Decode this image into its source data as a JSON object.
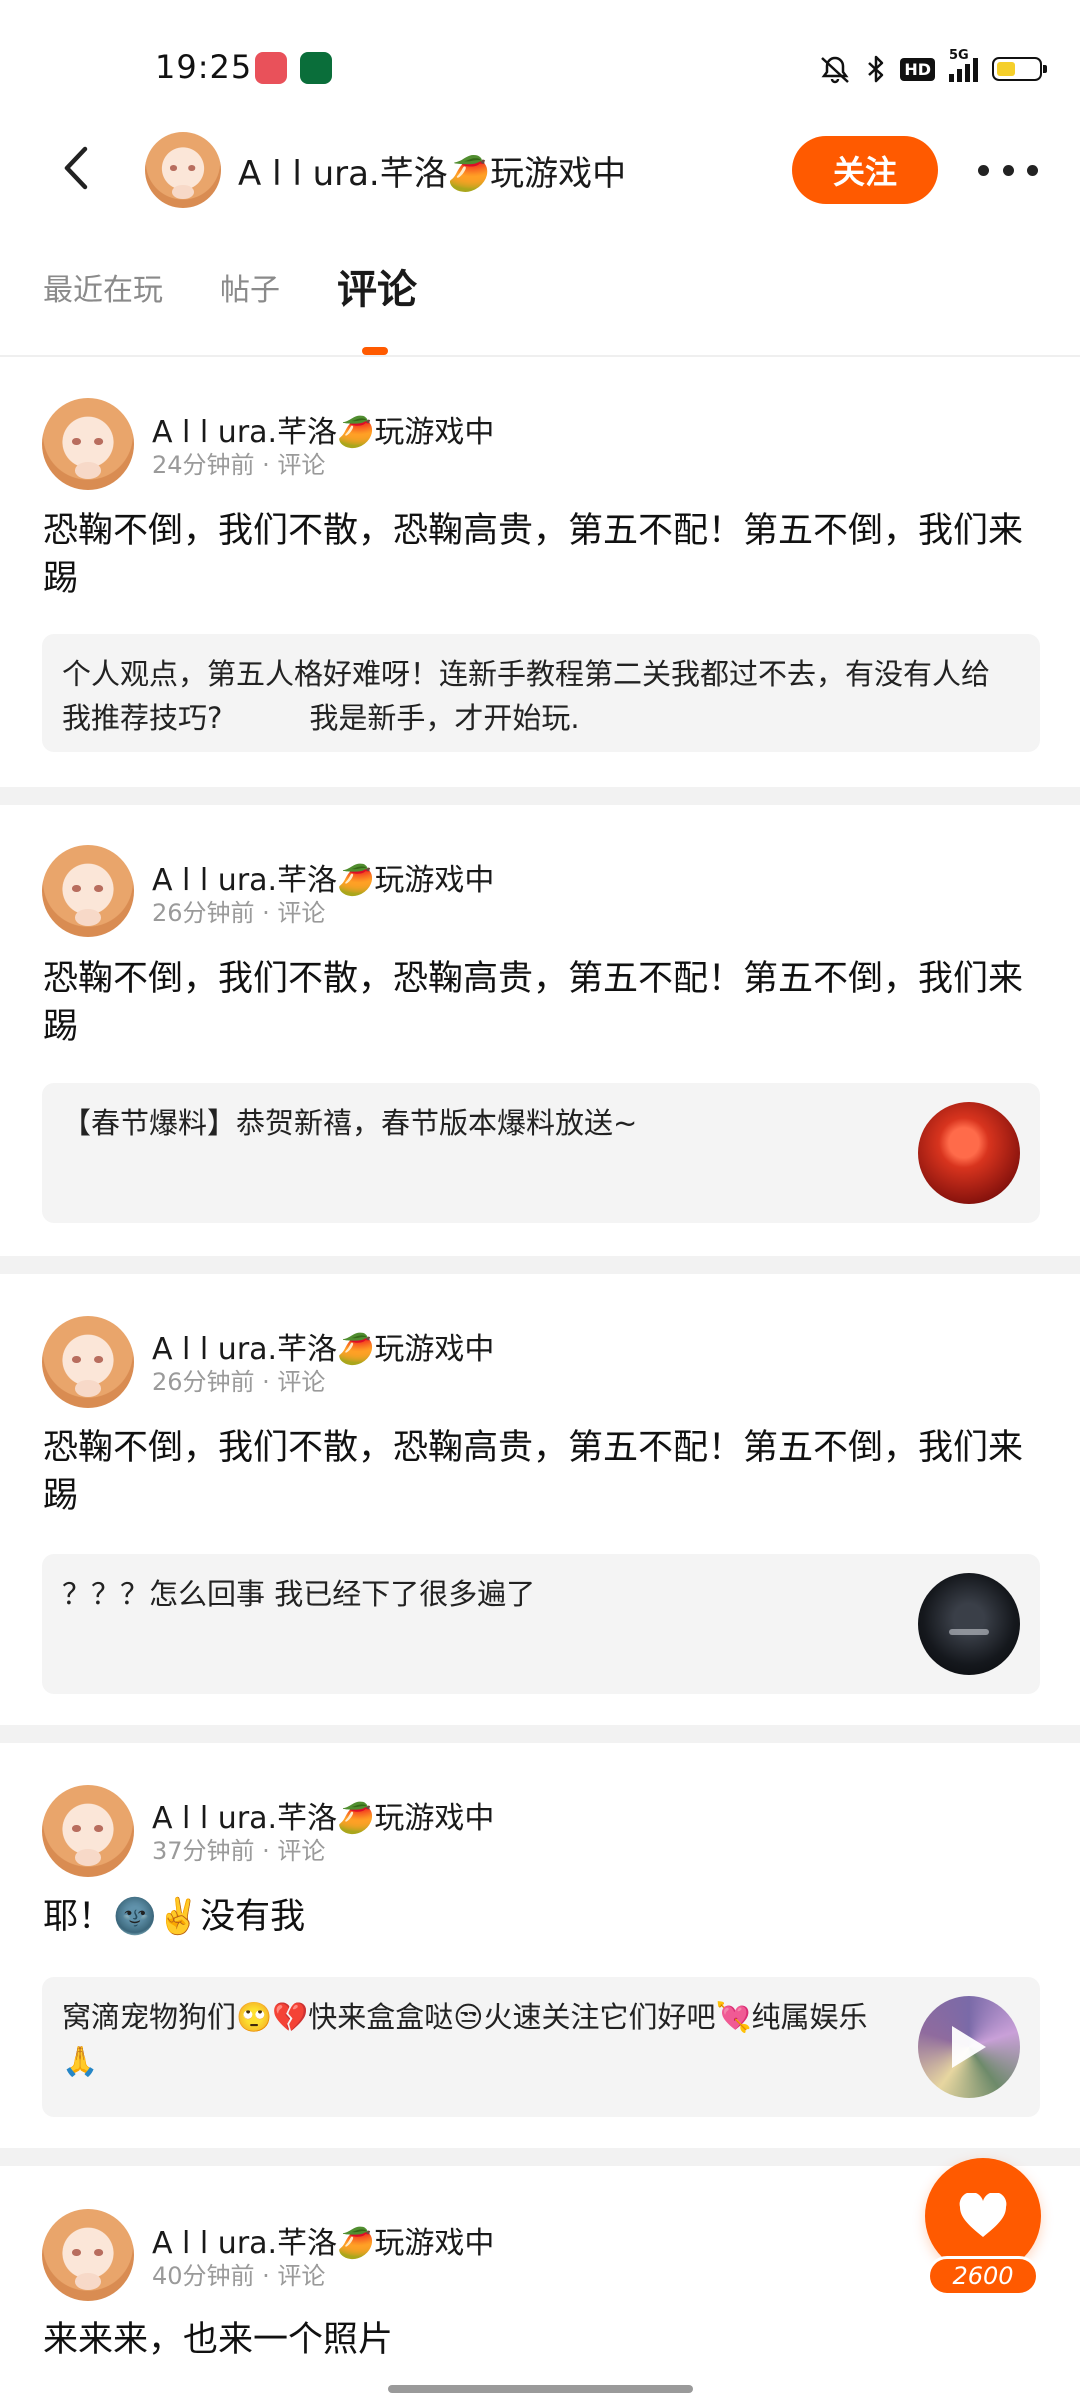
{
  "status_bar": {
    "time": "19:25",
    "hd_label": "HD",
    "network_label": "5G",
    "battery_percent": 40
  },
  "header": {
    "username": "A l l ura.芊洛🥭玩游戏中",
    "follow_label": "关注"
  },
  "tabs": [
    {
      "label": "最近在玩",
      "active": false
    },
    {
      "label": "帖子",
      "active": false
    },
    {
      "label": "评论",
      "active": true
    }
  ],
  "comments": [
    {
      "author": "A l l ura.芊洛🥭玩游戏中",
      "meta": "24分钟前 · 评论",
      "text": "恐鞠不倒，我们不散，恐鞠高贵，第五不配！第五不倒，我们来踢",
      "ref_text": "个人观点，第五人格好难呀！连新手教程第二关我都过不去，有没有人给我推荐技巧?　　　我是新手，才开始玩.",
      "thumb": null
    },
    {
      "author": "A l l ura.芊洛🥭玩游戏中",
      "meta": "26分钟前 · 评论",
      "text": "恐鞠不倒，我们不散，恐鞠高贵，第五不配！第五不倒，我们来踢",
      "ref_text": "【春节爆料】恭贺新禧，春节版本爆料放送~",
      "thumb": "red"
    },
    {
      "author": "A l l ura.芊洛🥭玩游戏中",
      "meta": "26分钟前 · 评论",
      "text": "恐鞠不倒，我们不散，恐鞠高贵，第五不配！第五不倒，我们来踢",
      "ref_text": "？？？怎么回事 我已经下了很多遍了",
      "thumb": "dark"
    },
    {
      "author": "A l l ura.芊洛🥭玩游戏中",
      "meta": "37分钟前 · 评论",
      "text": "耶！🌚✌️没有我",
      "ref_text": "窝滴宠物狗们🙄💔快来盒盒哒😒火速关注它们好吧💘纯属娱乐🙏",
      "thumb": "video"
    },
    {
      "author": "A l l ura.芊洛🥭玩游戏中",
      "meta": "40分钟前 · 评论",
      "text": "来来来，也来一个照片",
      "ref_text": "",
      "thumb": null
    }
  ],
  "like": {
    "count": "2600"
  },
  "colors": {
    "accent": "#ff5a00",
    "separator": "#f2f2f2",
    "ref_background": "#f4f4f4"
  },
  "icons": [
    "back-arrow-icon",
    "more-icon",
    "heart-icon",
    "mute-icon",
    "bluetooth-icon",
    "signal-icon",
    "battery-icon",
    "play-icon"
  ]
}
